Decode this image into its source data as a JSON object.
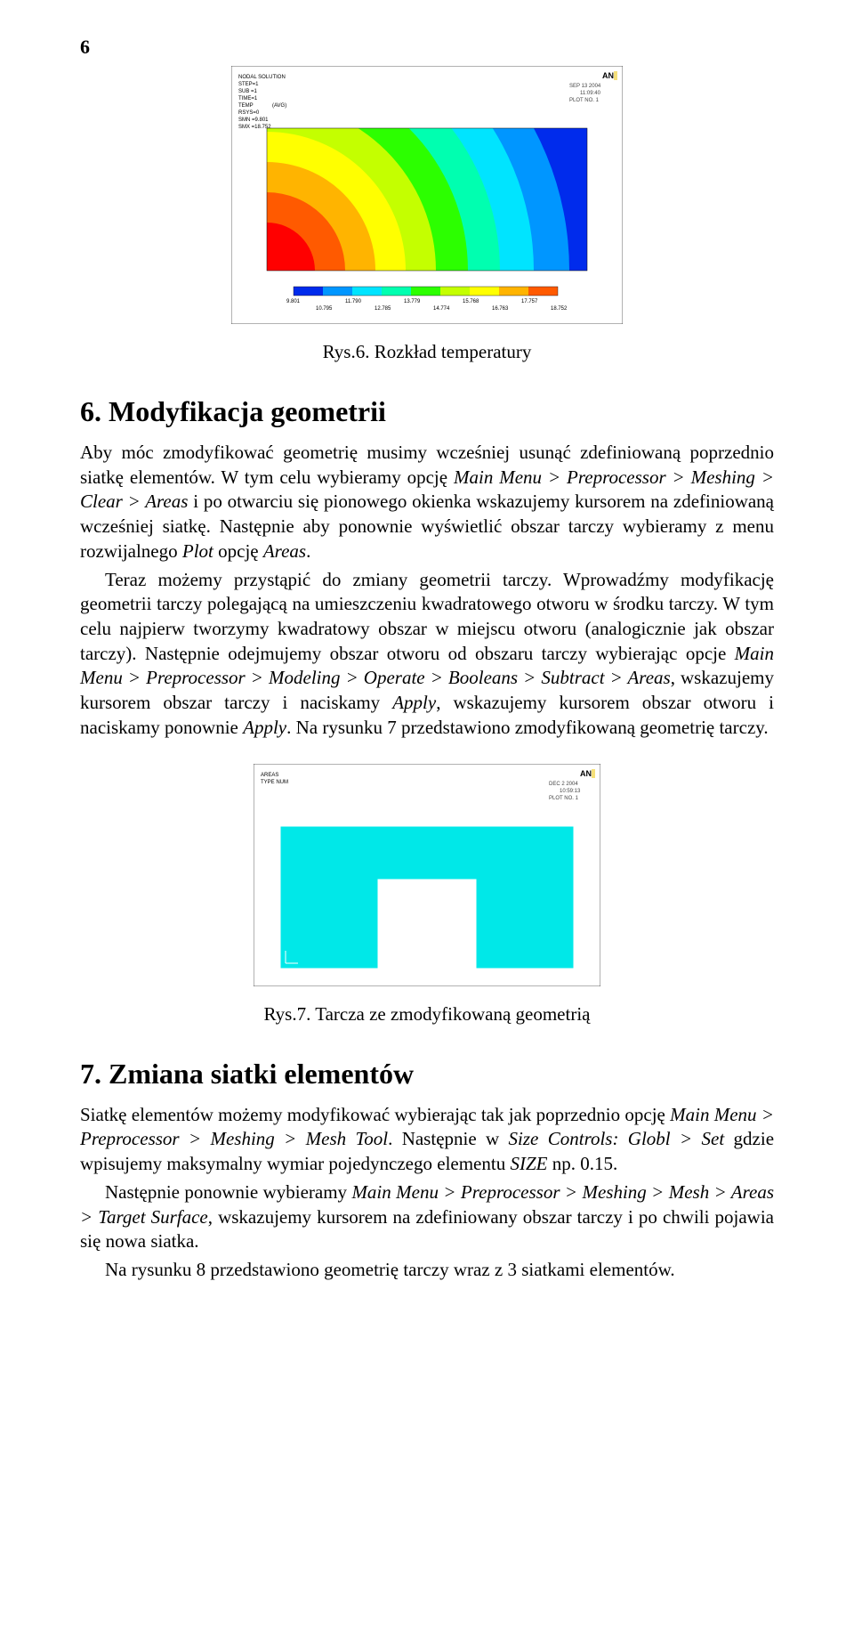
{
  "pageNumber": "6",
  "fig6": {
    "caption": "Rys.6. Rozkład temperatury",
    "ansys": {
      "t1": "NODAL SOLUTION",
      "t2": "STEP=1",
      "t3": "SUB =1",
      "t4": "TIME=1",
      "t5a": "TEMP",
      "t5b": "(AVG)",
      "t6": "RSYS=0",
      "t7": "SMN =9.801",
      "t8": "SMX =18.752",
      "logo": "AN",
      "d1": "SEP 13 2004",
      "d2": "11:09:40",
      "d3": "PLOT NO.   1"
    },
    "scale": [
      "9.801",
      "10.795",
      "11.790",
      "12.785",
      "13.779",
      "14.774",
      "15.768",
      "16.763",
      "17.757",
      "18.752"
    ]
  },
  "sec6": {
    "title": "6.   Modyfikacja geometrii",
    "p1a": "Aby móc zmodyfikować geometrię musimy wcześniej usunąć zdefiniowaną poprzednio siatkę elementów. W tym celu wybieramy opcję ",
    "p1b": "Main Menu > Preprocessor > Meshing > Clear > Areas",
    "p1c": " i po otwarciu się pionowego okienka wskazujemy kursorem na zdefiniowaną wcześniej siatkę. Następnie aby ponownie wyświetlić obszar tarczy wybieramy z menu rozwijalnego ",
    "p1d": "Plot",
    "p1e": " opcję ",
    "p1f": "Areas",
    "p1g": ".",
    "p2a": "Teraz możemy przystąpić do zmiany geometrii tarczy. Wprowadźmy modyfikację geometrii tarczy polegającą na umieszczeniu kwadratowego otworu w środku tarczy. W tym celu najpierw tworzymy kwadratowy obszar w miejscu otworu (analogicznie jak obszar tarczy). Następnie odejmujemy obszar otworu od obszaru tarczy wybierając opcje ",
    "p2b": "Main Menu > Preprocessor > Modeling > Operate > Booleans > Subtract > Areas",
    "p2c": ", wskazujemy kursorem obszar tarczy i naciskamy ",
    "p2d": "Apply",
    "p2e": ", wskazujemy kursorem obszar otworu i naciskamy ponownie ",
    "p2f": "Apply",
    "p2g": ". Na rysunku 7 przedstawiono zmodyfikowaną geometrię tarczy."
  },
  "fig7": {
    "caption": "Rys.7. Tarcza ze zmodyfikowaną geometrią",
    "ansys": {
      "t1": "AREAS",
      "t2": "TYPE NUM",
      "logo": "AN",
      "d1": "DEC  2 2004",
      "d2": "10:59:13",
      "d3": "PLOT NO.   1"
    }
  },
  "sec7": {
    "title": "7.   Zmiana siatki elementów",
    "p1a": "Siatkę elementów możemy modyfikować wybierając tak jak poprzednio opcję ",
    "p1b": "Main Menu > Preprocessor > Meshing > Mesh Tool",
    "p1c": ". Następnie w ",
    "p1d": "Size Controls: Globl > Set",
    "p1e": " gdzie wpisujemy maksymalny wymiar pojedynczego elementu ",
    "p1f": "SIZE",
    "p1g": " np. 0.15.",
    "p2a": "Następnie ponownie wybieramy ",
    "p2b": "Main Menu > Preprocessor > Meshing > Mesh > Areas > Target Surface",
    "p2c": ", wskazujemy kursorem na zdefiniowany obszar tarczy i po chwili pojawia się nowa siatka.",
    "p3": "Na rysunku 8 przedstawiono geometrię tarczy wraz z 3 siatkami elementów."
  },
  "chart_data": {
    "type": "heatmap",
    "title": "NODAL SOLUTION — TEMP (AVG)",
    "xlabel": "",
    "ylabel": "",
    "legend": {
      "values": [
        9.801,
        10.795,
        11.79,
        12.785,
        13.779,
        14.774,
        15.768,
        16.763,
        17.757,
        18.752
      ],
      "colors": [
        "#002bec",
        "#0096ff",
        "#00e4ff",
        "#00ffb0",
        "#2cff00",
        "#c4ff00",
        "#ffff00",
        "#ffb400",
        "#ff5a00",
        "#ff0000"
      ]
    },
    "annotations": [
      "STEP=1",
      "SUB =1",
      "TIME=1",
      "RSYS=0",
      "SMN =9.801",
      "SMX =18.752",
      "SEP 13 2004",
      "11:09:40",
      "PLOT NO. 1"
    ]
  }
}
